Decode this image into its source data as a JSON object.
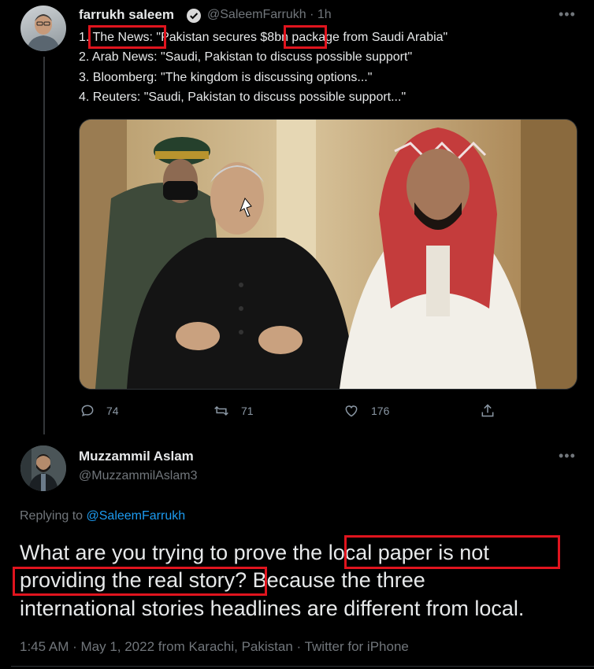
{
  "tweet": {
    "author_name": "farrukh saleem",
    "handle_time": "@SaleemFarrukh · 1h",
    "lines": [
      {
        "num": "1.",
        "source": "The News:",
        "pre": "\"Pakistan secures ",
        "highlight": "$8bn",
        "post": " package from Saudi Arabia\""
      },
      {
        "text": "2. Arab News: \"Saudi, Pakistan to discuss possible support\""
      },
      {
        "text": "3. Bloomberg: \"The kingdom is discussing options...\""
      },
      {
        "text": "4. Reuters: \"Saudi, Pakistan to discuss possible support...\""
      }
    ],
    "actions": {
      "reply_count": "74",
      "retweet_count": "71",
      "like_count": "176"
    },
    "more": "•••"
  },
  "reply": {
    "author_name": "Muzzammil Aslam",
    "handle": "@MuzzammilAslam3",
    "replying_prefix": "Replying to ",
    "replying_handle": "@SaleemFarrukh",
    "text_line1_pre": "What are you trying to prove the ",
    "text_line1_hl": "local paper is not",
    "text_line2_hl": "providing the real story?",
    "text_line2_post": " Because the three",
    "text_line3": "international stories headlines are different from local.",
    "meta": "1:45 AM · May 1, 2022 from Karachi, Pakistan · Twitter for iPhone",
    "more": "•••"
  },
  "colors": {
    "background": "#000000",
    "highlight_box": "#e0141e",
    "link": "#1d9bf0",
    "muted": "#71767b"
  }
}
